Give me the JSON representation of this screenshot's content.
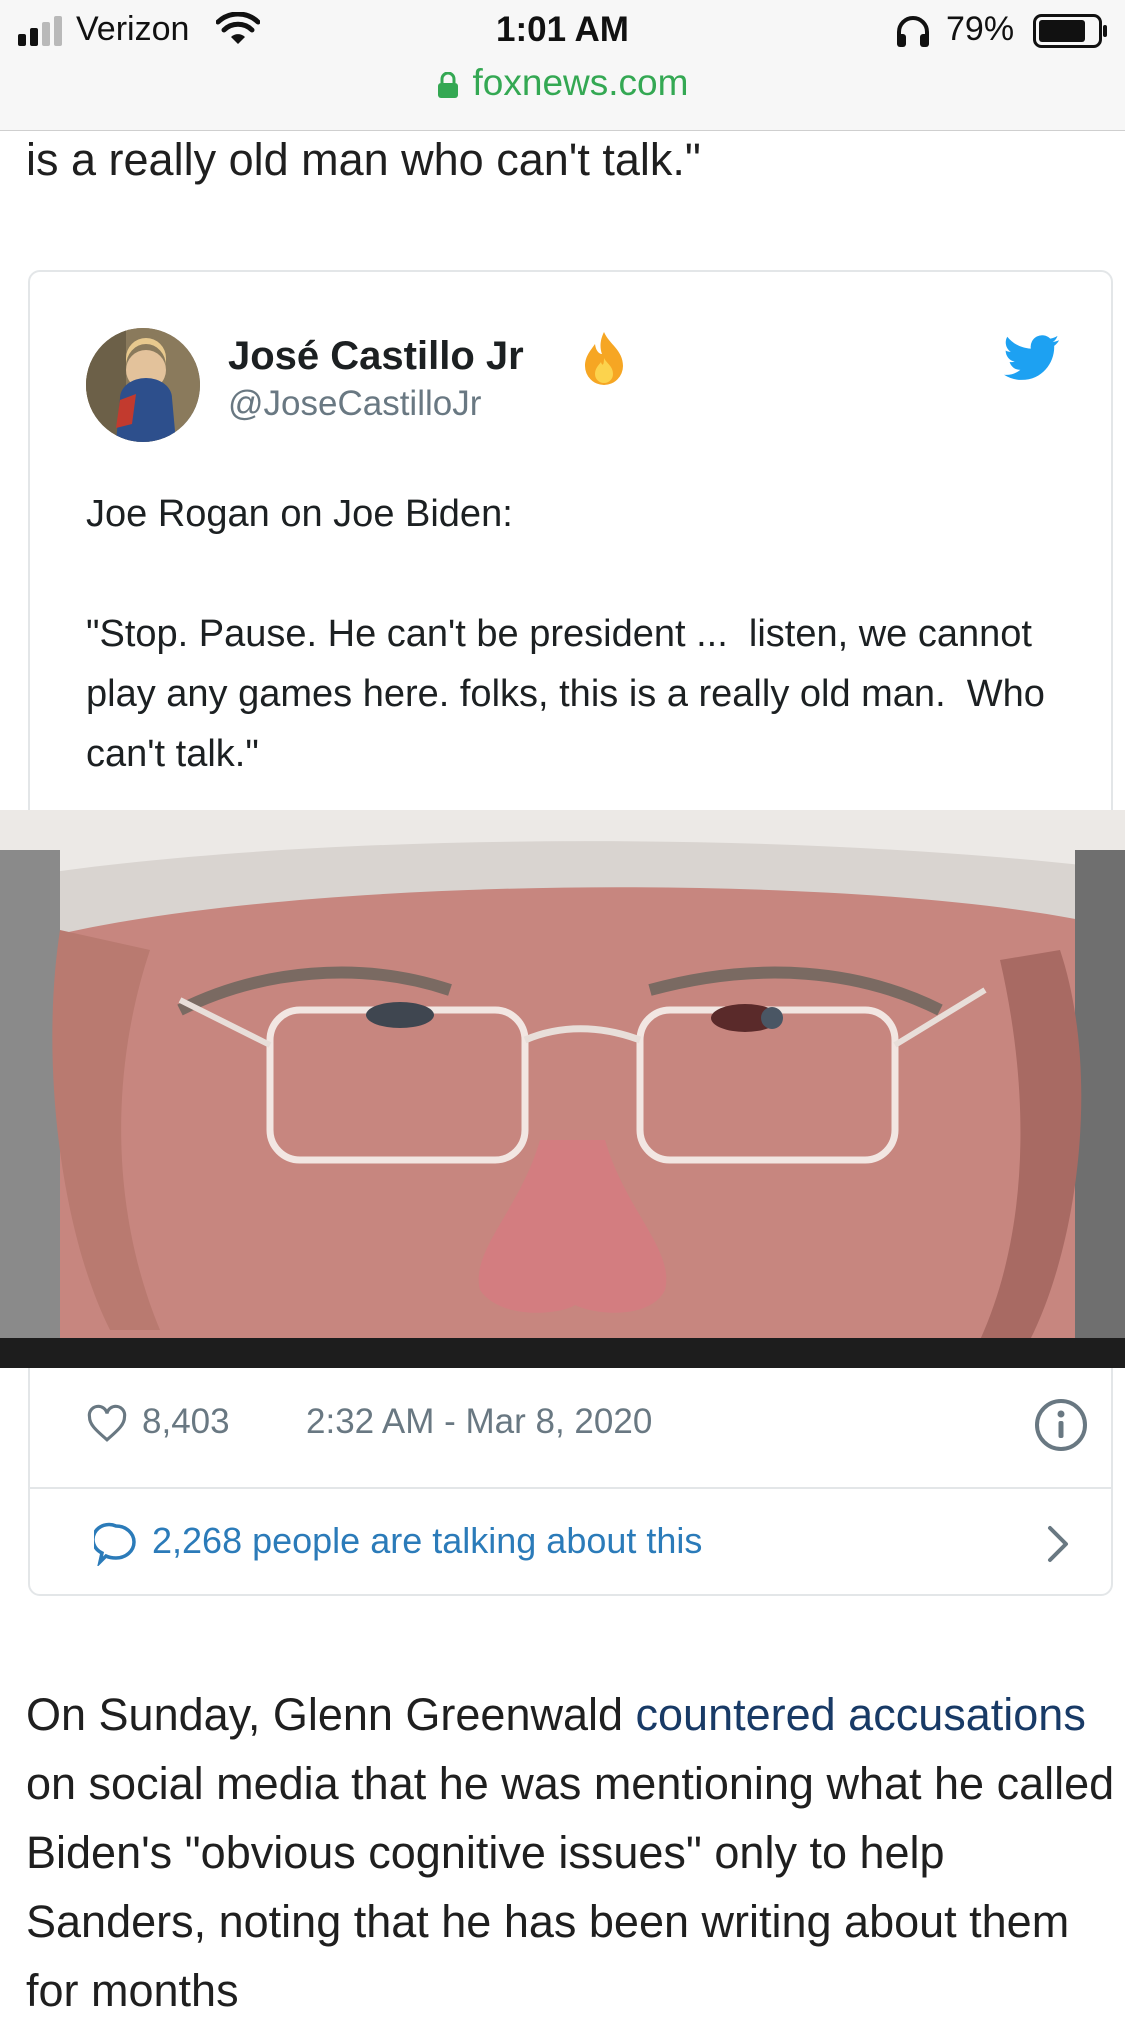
{
  "status_bar": {
    "carrier": "Verizon",
    "time": "1:01 AM",
    "battery": "79%",
    "battery_level": 0.79
  },
  "browser": {
    "url": "foxnews.com"
  },
  "article": {
    "quote_tail": "is a really old man who can't talk.\"",
    "paragraph_before": "On Sunday, Glenn Greenwald ",
    "paragraph_link": "countered accusations",
    "paragraph_after": " on social media that he was mentioning what he called Biden's \"obvious cognitive issues\" only to help Sanders, noting that he has been writing about them for months"
  },
  "tweet": {
    "author_name": "José Castillo Jr",
    "handle": "@JoseCastilloJr",
    "text": "Joe Rogan on Joe Biden:\n\n\"Stop. Pause. He can't be president ...  listen, we cannot play any games here. folks, this is a really old man.  Who can't talk.\"",
    "likes": "8,403",
    "timestamp": "2:32 AM - Mar 8, 2020",
    "talking": "2,268 people are talking about this"
  },
  "colors": {
    "link": "#183a66",
    "twitter_blue": "#1da1f2",
    "url_green": "#34a853",
    "meta_gray": "#697882"
  },
  "icons": [
    "signal-icon",
    "wifi-icon",
    "headphones-icon",
    "battery-icon",
    "lock-icon",
    "fire-emoji-icon",
    "twitter-bird-icon",
    "heart-icon",
    "info-icon",
    "speech-bubble-icon",
    "chevron-right-icon"
  ]
}
